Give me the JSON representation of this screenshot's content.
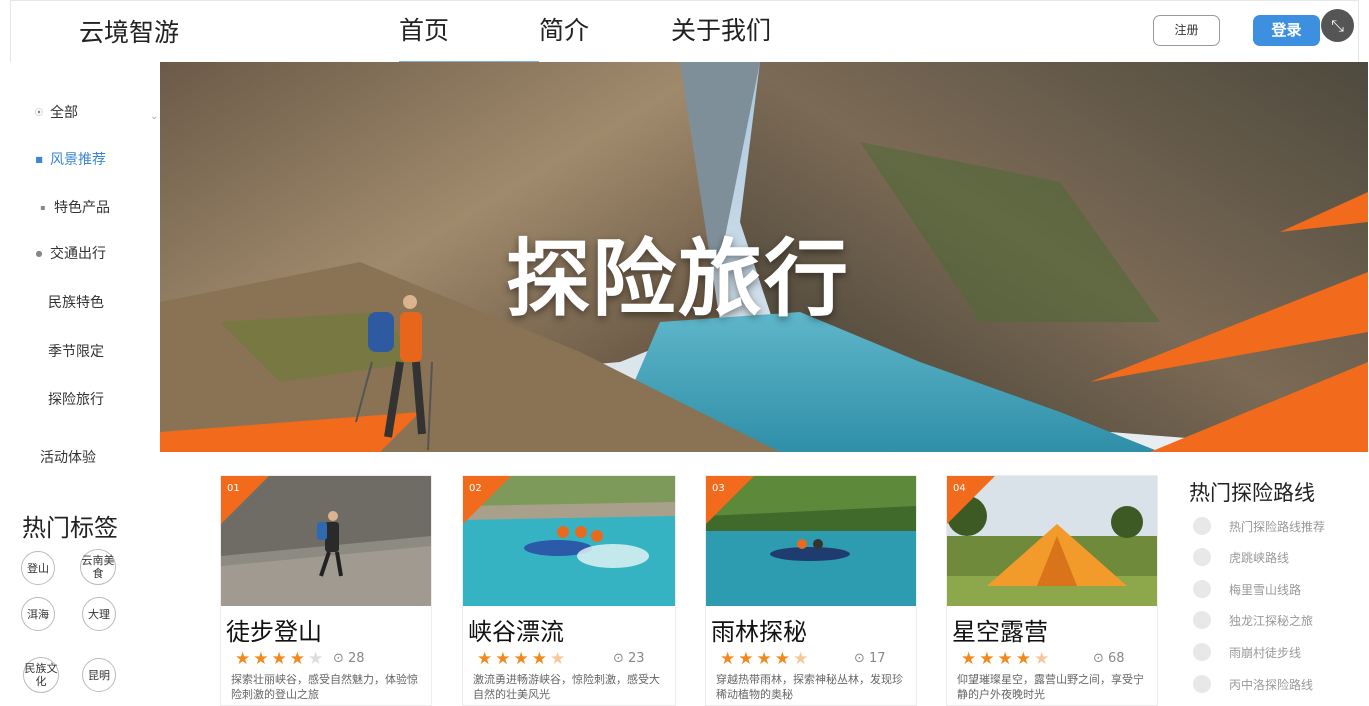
{
  "header": {
    "brand": "云境智游",
    "nav": [
      "首页",
      "简介",
      "关于我们"
    ],
    "register": "注册",
    "login": "登录"
  },
  "sidebar": {
    "items": [
      {
        "label": "全部",
        "icon": "pin-icon"
      },
      {
        "label": "风景推荐",
        "icon": "square-icon",
        "active": true
      },
      {
        "label": "特色产品",
        "icon": "grid-icon"
      },
      {
        "label": "交通出行",
        "icon": "circle-icon"
      },
      {
        "label": "民族特色",
        "icon": ""
      },
      {
        "label": "季节限定",
        "icon": ""
      },
      {
        "label": "探险旅行",
        "icon": ""
      },
      {
        "label": "活动体验",
        "icon": ""
      }
    ],
    "tags_title": "热门标签",
    "tags": [
      "登山",
      "云南美食",
      "洱海",
      "大理",
      "民族文化",
      "昆明"
    ]
  },
  "hero": {
    "title": "探险旅行"
  },
  "cards": [
    {
      "num": "01",
      "title": "徒步登山",
      "stars": 4.0,
      "meta": "28",
      "desc": "探索壮丽峡谷，感受自然魅力，体验惊险刺激的登山之旅"
    },
    {
      "num": "02",
      "title": "峡谷漂流",
      "stars": 4.5,
      "meta": "23",
      "desc": "激流勇进畅游峡谷，惊险刺激，感受大自然的壮美风光"
    },
    {
      "num": "03",
      "title": "雨林探秘",
      "stars": 4.5,
      "meta": "17",
      "desc": "穿越热带雨林，探索神秘丛林，发现珍稀动植物的奥秘"
    },
    {
      "num": "04",
      "title": "星空露营",
      "stars": 4.5,
      "meta": "68",
      "desc": "仰望璀璨星空，露营山野之间，享受宁静的户外夜晚时光"
    }
  ],
  "routes": {
    "title": "热门探险路线",
    "items": [
      "热门探险路线推荐",
      "虎跳峡路线",
      "梅里雪山线路",
      "独龙江探秘之旅",
      "雨崩村徒步线",
      "丙中洛探险路线"
    ]
  },
  "colors": {
    "accent": "#f26a1b",
    "primary": "#3d8fe0"
  }
}
